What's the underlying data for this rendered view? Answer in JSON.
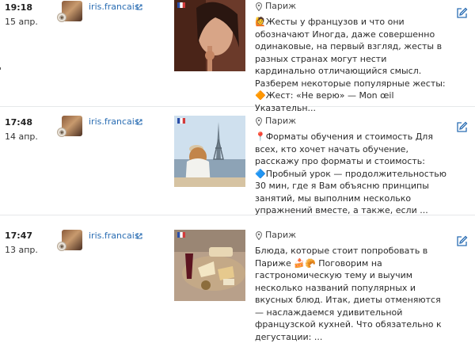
{
  "posts": [
    {
      "time": "19:18",
      "date": "15 апр.",
      "account": "iris.francais",
      "location": "Париж",
      "text": "🙋Жесты у французов и что они обозначают Иногда, даже совершенно одинаковые, на первый взгляд, жесты в разных странах могут нести кардинально отличающийся смысл. Разберем некоторые популярные жесты: 🔶Жест: «Не верю» — Mon œil Указательн..."
    },
    {
      "time": "17:48",
      "date": "14 апр.",
      "account": "iris.francais",
      "location": "Париж",
      "text": "📍Форматы обучения и стоимость Для всех, кто хочет начать обучение, расскажу про форматы и стоимость: 🔷Пробный урок — продолжительностью 30 мин, где я Вам объясню принципы занятий, мы выполним несколько упражнений вместе, а также, если ..."
    },
    {
      "time": "17:47",
      "date": "13 апр.",
      "account": "iris.francais",
      "location": "Париж",
      "text": "Блюда, которые стоит попробовать в Париже 🍰🥐 Поговорим на гастрономическую тему и выучим несколько названий популярных и вкусных блюд. Итак, диеты отменяются — наслаждаемся удивительной французской кухней. Что обязательно к дегустации: ..."
    }
  ],
  "icons": {
    "external": "external-link-icon",
    "pin": "map-pin-icon",
    "edit": "edit-icon",
    "flag": "french-flag-icon"
  },
  "colors": {
    "link": "#2a6db3",
    "separator": "#e6e8ea"
  }
}
